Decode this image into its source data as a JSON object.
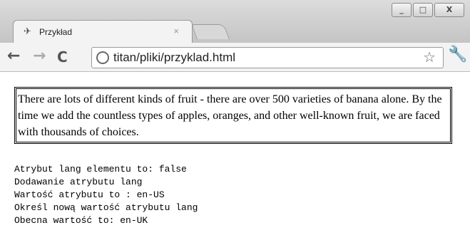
{
  "browser": {
    "tab": {
      "title": "Przykład",
      "close": "×"
    },
    "address": {
      "url": "titan/pliki/przyklad.html"
    },
    "window_buttons": [
      "_",
      "□",
      "X"
    ]
  },
  "page": {
    "paragraph": "There are lots of different kinds of fruit - there are over 500 varieties of banana alone. By the time we add the countless types of apples, oranges, and other well-known fruit, we are faced with thousands of choices.",
    "output": [
      "Atrybut lang elementu to: false",
      "Dodawanie atrybutu lang",
      "Wartość atrybutu to : en-US",
      "Określ nową wartość atrybutu lang",
      "Obecna wartość to: en-UK"
    ]
  }
}
